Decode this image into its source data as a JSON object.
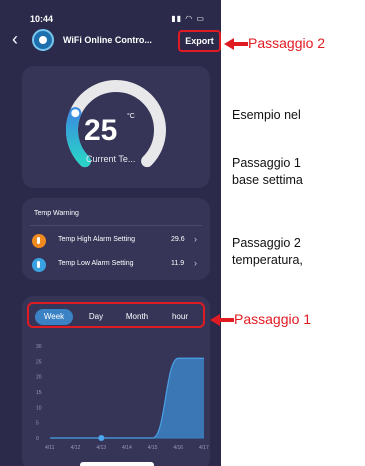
{
  "status": {
    "time": "10:44"
  },
  "header": {
    "title": "WiFi Online Contro...",
    "export_label": "Export"
  },
  "gauge": {
    "value": "25",
    "unit": "°C",
    "label": "Current Te...",
    "progress": 0.25
  },
  "temp_warning": {
    "title": "Temp Warning",
    "rows": [
      {
        "label": "Temp High Alarm Setting",
        "value": "29.6"
      },
      {
        "label": "Temp Low Alarm Setting",
        "value": "11.9"
      }
    ]
  },
  "tabs": [
    {
      "label": "Week",
      "active": true
    },
    {
      "label": "Day",
      "active": false
    },
    {
      "label": "Month",
      "active": false
    },
    {
      "label": "hour",
      "active": false
    }
  ],
  "chart_data": {
    "type": "area",
    "x": [
      "4/11",
      "4/12",
      "4/13",
      "4/14",
      "4/15",
      "4/16",
      "4/17"
    ],
    "values": [
      0,
      0,
      0,
      0,
      0,
      26,
      26
    ],
    "ylim": [
      0,
      30
    ],
    "yticks": [
      "0",
      "5",
      "10",
      "15",
      "20",
      "25",
      "30"
    ],
    "marker_index": 2
  },
  "annotations": {
    "step2_label": "Passaggio 2",
    "step1_label": "Passaggio 1",
    "example_text": "Esempio nel",
    "step1_text_1": "Passaggio 1",
    "step1_text_2": "base settima",
    "step2_text_1": "Passaggio 2",
    "step2_text_2": "temperatura,"
  },
  "colors": {
    "accent": "#e11b22",
    "phone_bg": "#2b2a4a",
    "card_bg": "#363558",
    "chart_blue": "#3b82c4"
  }
}
